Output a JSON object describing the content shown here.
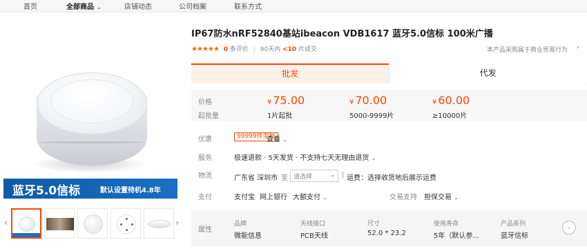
{
  "nav": {
    "items": [
      "首页",
      "全部商品",
      "店铺动态",
      "公司档案",
      "联系方式"
    ]
  },
  "gallery": {
    "banner_big": "蓝牙5.0信标",
    "banner_small": "默认设置待机4.8年",
    "prev_icon": "chevron-left-icon",
    "next_icon": "chevron-right-icon",
    "thumbs": [
      "beacon-front",
      "beacon-in-room-photo",
      "beacon-top",
      "beacon-back",
      "beacon-side"
    ]
  },
  "product": {
    "title": "IP67防水nRF52840基站ibeacon VDB1617 蓝牙5.0信标 100米广播",
    "stars": "★★★★★",
    "review_count": "0",
    "review_label": "条评价",
    "days_label": "90天内",
    "sold_count": "<10",
    "sold_label": "片成交",
    "report": "本产品采购属于商业贸易行为"
  },
  "tabs": {
    "wholesale": "批发",
    "agency": "代发"
  },
  "pricing": {
    "price_label": "价格",
    "batch_label": "起批量",
    "yen": "¥",
    "tiers": [
      {
        "price": "75.00",
        "batch": "1片起批"
      },
      {
        "price": "70.00",
        "batch": "5000-9999片"
      },
      {
        "price": "60.00",
        "batch": "≥10000片"
      }
    ]
  },
  "promo": {
    "label": "优惠",
    "badge": "99999件混批",
    "view": "查看"
  },
  "service": {
    "label": "服务",
    "text": "极速退款 · 5天发货 · 不支持七天无理由退货"
  },
  "logistics": {
    "label": "物流",
    "origin": "广东省 深圳市",
    "to": "至",
    "select_placeholder": "请选择",
    "fee": "运费：选择收货地后展示运费"
  },
  "payment": {
    "label": "支付",
    "methods": [
      "支付宝",
      "网上银行",
      "大额支付"
    ],
    "trade_label": "交易支持",
    "trade_value": "担保交易"
  },
  "attributes": {
    "label": "属性",
    "items": [
      {
        "key": "品牌",
        "value": "微能信息"
      },
      {
        "key": "天线接口",
        "value": "PCB天线"
      },
      {
        "key": "尺寸",
        "value": "52.0 * 23.2"
      },
      {
        "key": "使用寿命",
        "value": "5年（默认参..."
      },
      {
        "key": "产品系列",
        "value": "蓝牙信标"
      }
    ]
  }
}
